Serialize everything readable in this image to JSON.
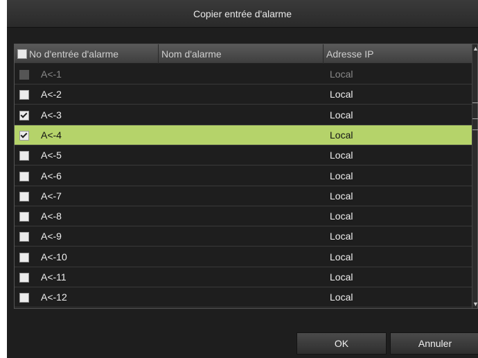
{
  "dialog": {
    "title": "Copier entrée d'alarme"
  },
  "table": {
    "headers": {
      "col1": "No d'entrée d'alarme",
      "col2": "Nom d'alarme",
      "col3": "Adresse IP"
    },
    "rows": [
      {
        "input": "A<-1",
        "name": "",
        "ip": "Local",
        "checked": false,
        "disabled": true,
        "selected": false
      },
      {
        "input": "A<-2",
        "name": "",
        "ip": "Local",
        "checked": false,
        "disabled": false,
        "selected": false
      },
      {
        "input": "A<-3",
        "name": "",
        "ip": "Local",
        "checked": true,
        "disabled": false,
        "selected": false
      },
      {
        "input": "A<-4",
        "name": "",
        "ip": "Local",
        "checked": true,
        "disabled": false,
        "selected": true
      },
      {
        "input": "A<-5",
        "name": "",
        "ip": "Local",
        "checked": false,
        "disabled": false,
        "selected": false
      },
      {
        "input": "A<-6",
        "name": "",
        "ip": "Local",
        "checked": false,
        "disabled": false,
        "selected": false
      },
      {
        "input": "A<-7",
        "name": "",
        "ip": "Local",
        "checked": false,
        "disabled": false,
        "selected": false
      },
      {
        "input": "A<-8",
        "name": "",
        "ip": "Local",
        "checked": false,
        "disabled": false,
        "selected": false
      },
      {
        "input": "A<-9",
        "name": "",
        "ip": "Local",
        "checked": false,
        "disabled": false,
        "selected": false
      },
      {
        "input": "A<-10",
        "name": "",
        "ip": "Local",
        "checked": false,
        "disabled": false,
        "selected": false
      },
      {
        "input": "A<-11",
        "name": "",
        "ip": "Local",
        "checked": false,
        "disabled": false,
        "selected": false
      },
      {
        "input": "A<-12",
        "name": "",
        "ip": "Local",
        "checked": false,
        "disabled": false,
        "selected": false
      }
    ]
  },
  "buttons": {
    "ok": "OK",
    "cancel": "Annuler"
  },
  "colors": {
    "selected_row": "#b5d36a",
    "background": "#1e1e1e"
  }
}
